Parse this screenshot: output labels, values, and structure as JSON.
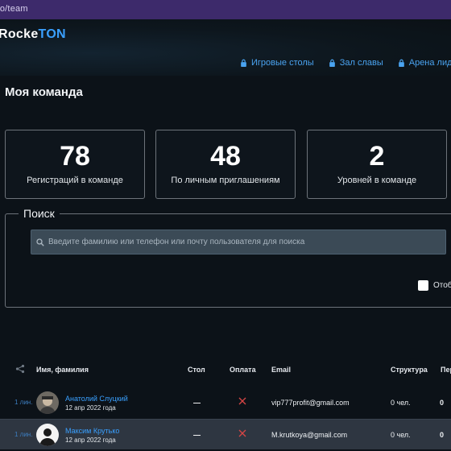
{
  "browser": {
    "url": "ro/team"
  },
  "header": {
    "logo_main": "Rocke",
    "logo_accent": "TON",
    "nav": [
      {
        "label": "Игровые столы"
      },
      {
        "label": "Зал славы"
      },
      {
        "label": "Арена лидер"
      }
    ]
  },
  "page": {
    "title": "Моя команда"
  },
  "stats": [
    {
      "value": "78",
      "label": "Регистраций в команде"
    },
    {
      "value": "48",
      "label": "По личным приглашениям"
    },
    {
      "value": "2",
      "label": "Уровней в команде"
    }
  ],
  "search": {
    "legend": "Поиск",
    "placeholder": "Введите фамилию или телефон или почту пользователя для поиска",
    "checkbox_label": "Отоб"
  },
  "table": {
    "columns": [
      "Имя, фамилия",
      "Стол",
      "Оплата",
      "Email",
      "Структура",
      "Пер"
    ],
    "rows": [
      {
        "level": "1 лин.",
        "name": "Анатолий Слуцкий",
        "date": "12 апр 2022 года",
        "table": "—",
        "paid": "no",
        "email": "vip777profit@gmail.com",
        "structure": "0 чел.",
        "extra": "0"
      },
      {
        "level": "1 лин.",
        "name": "Максим Крутько",
        "date": "12 апр 2022 года",
        "table": "—",
        "paid": "no",
        "email": "M.krutkoya@gmail.com",
        "structure": "0 чел.",
        "extra": "0"
      }
    ]
  },
  "colors": {
    "accent": "#3aa0ff",
    "pay_no": "#d64545",
    "browser_bar": "#3d2a6b"
  }
}
